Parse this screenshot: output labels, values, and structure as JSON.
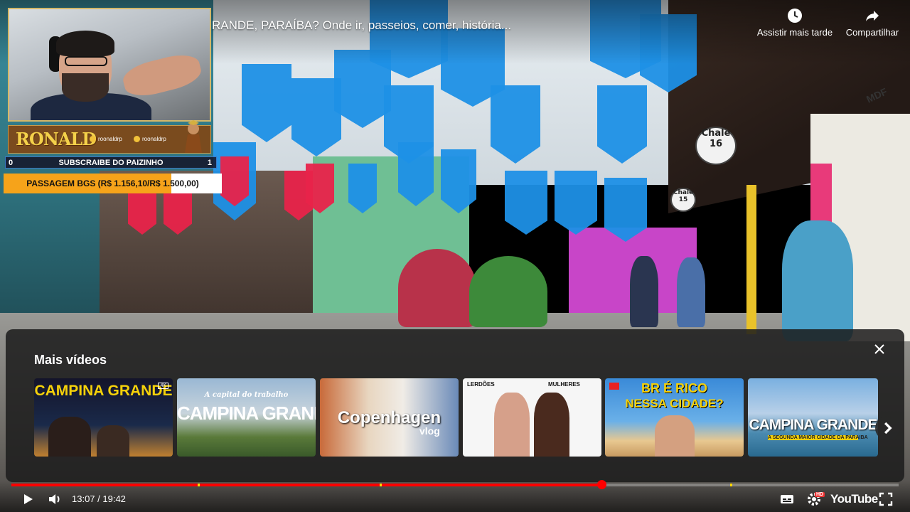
{
  "video": {
    "title": "RANDE, PARAÍBA? Onde ir, passeios, comer, história..."
  },
  "top_actions": [
    {
      "label": "Assistir mais tarde",
      "icon": "clock-icon"
    },
    {
      "label": "Compartilhar",
      "icon": "share-icon"
    }
  ],
  "scene": {
    "signs": [
      "Chale 16",
      "Chale 15",
      "MDF"
    ]
  },
  "overlay": {
    "streamer_name": "RONALD",
    "handles": [
      "roonaldrp",
      "roonaldrp"
    ],
    "goal": {
      "left": "0",
      "label": "SUBSCRAIBE DO PAIZINHO",
      "right": "1"
    },
    "bgs": {
      "label": "PASSAGEM BGS (R$ 1.156,10/R$ 1.500,00)",
      "progress": 0.77
    }
  },
  "more_videos": {
    "title": "Mais vídeos",
    "thumbnails": [
      {
        "text": "CAMPINA GRANDE",
        "badge": "4K"
      },
      {
        "text": "CAMPINA GRANDE",
        "subtitle": "A capital do trabalho"
      },
      {
        "text": "Copenhagen",
        "subtitle": "vlog"
      },
      {
        "text": "LERDÕES",
        "subtitle": "MULHERES"
      },
      {
        "text": "BR É RICO",
        "subtitle": "NESSA CIDADE?"
      },
      {
        "text": "CAMPINA GRANDE",
        "subtitle": "A SEGUNDA MAIOR CIDADE DA PARAIBA"
      }
    ]
  },
  "player": {
    "time": "13:07 / 19:42",
    "progress": 0.6648,
    "brand": "YouTube",
    "hd_badge": "HD",
    "chapters": [
      0.21,
      0.415,
      0.81
    ]
  },
  "colors": {
    "accent": "#ff0000",
    "flag_blue": "#1e90e6",
    "bgs_orange": "#f6a31a",
    "streamer_gold": "#f4d14a"
  }
}
